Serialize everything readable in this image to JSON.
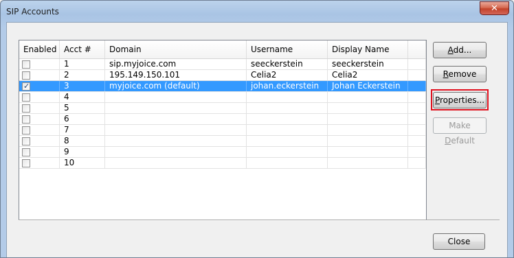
{
  "window": {
    "title": "SIP Accounts",
    "close_glyph": "✕"
  },
  "table": {
    "columns": [
      "Enabled",
      "Acct #",
      "Domain",
      "Username",
      "Display Name",
      ""
    ],
    "rows": [
      {
        "enabled": false,
        "acct": "1",
        "domain": "sip.myjoice.com",
        "username": "seeckerstein",
        "display": "seeckerstein"
      },
      {
        "enabled": false,
        "acct": "2",
        "domain": "195.149.150.101",
        "username": "Celia2",
        "display": "Celia2"
      },
      {
        "enabled": true,
        "acct": "3",
        "domain": "myjoice.com (default)",
        "username": "johan.eckerstein",
        "display": "Johan Eckerstein",
        "selected": true
      },
      {
        "enabled": false,
        "acct": "4",
        "domain": "",
        "username": "",
        "display": ""
      },
      {
        "enabled": false,
        "acct": "5",
        "domain": "",
        "username": "",
        "display": ""
      },
      {
        "enabled": false,
        "acct": "6",
        "domain": "",
        "username": "",
        "display": ""
      },
      {
        "enabled": false,
        "acct": "7",
        "domain": "",
        "username": "",
        "display": ""
      },
      {
        "enabled": false,
        "acct": "8",
        "domain": "",
        "username": "",
        "display": ""
      },
      {
        "enabled": false,
        "acct": "9",
        "domain": "",
        "username": "",
        "display": ""
      },
      {
        "enabled": false,
        "acct": "10",
        "domain": "",
        "username": "",
        "display": ""
      }
    ]
  },
  "buttons": {
    "add": {
      "access": "A",
      "rest": "dd..."
    },
    "remove": {
      "access": "R",
      "rest": "emove"
    },
    "properties": {
      "access": "P",
      "rest": "roperties..."
    },
    "make_default": {
      "pre": "Make ",
      "access": "D",
      "rest": "efault"
    },
    "close": "Close"
  },
  "colors": {
    "selection": "#3399ff",
    "highlight_border": "#e0101e"
  }
}
